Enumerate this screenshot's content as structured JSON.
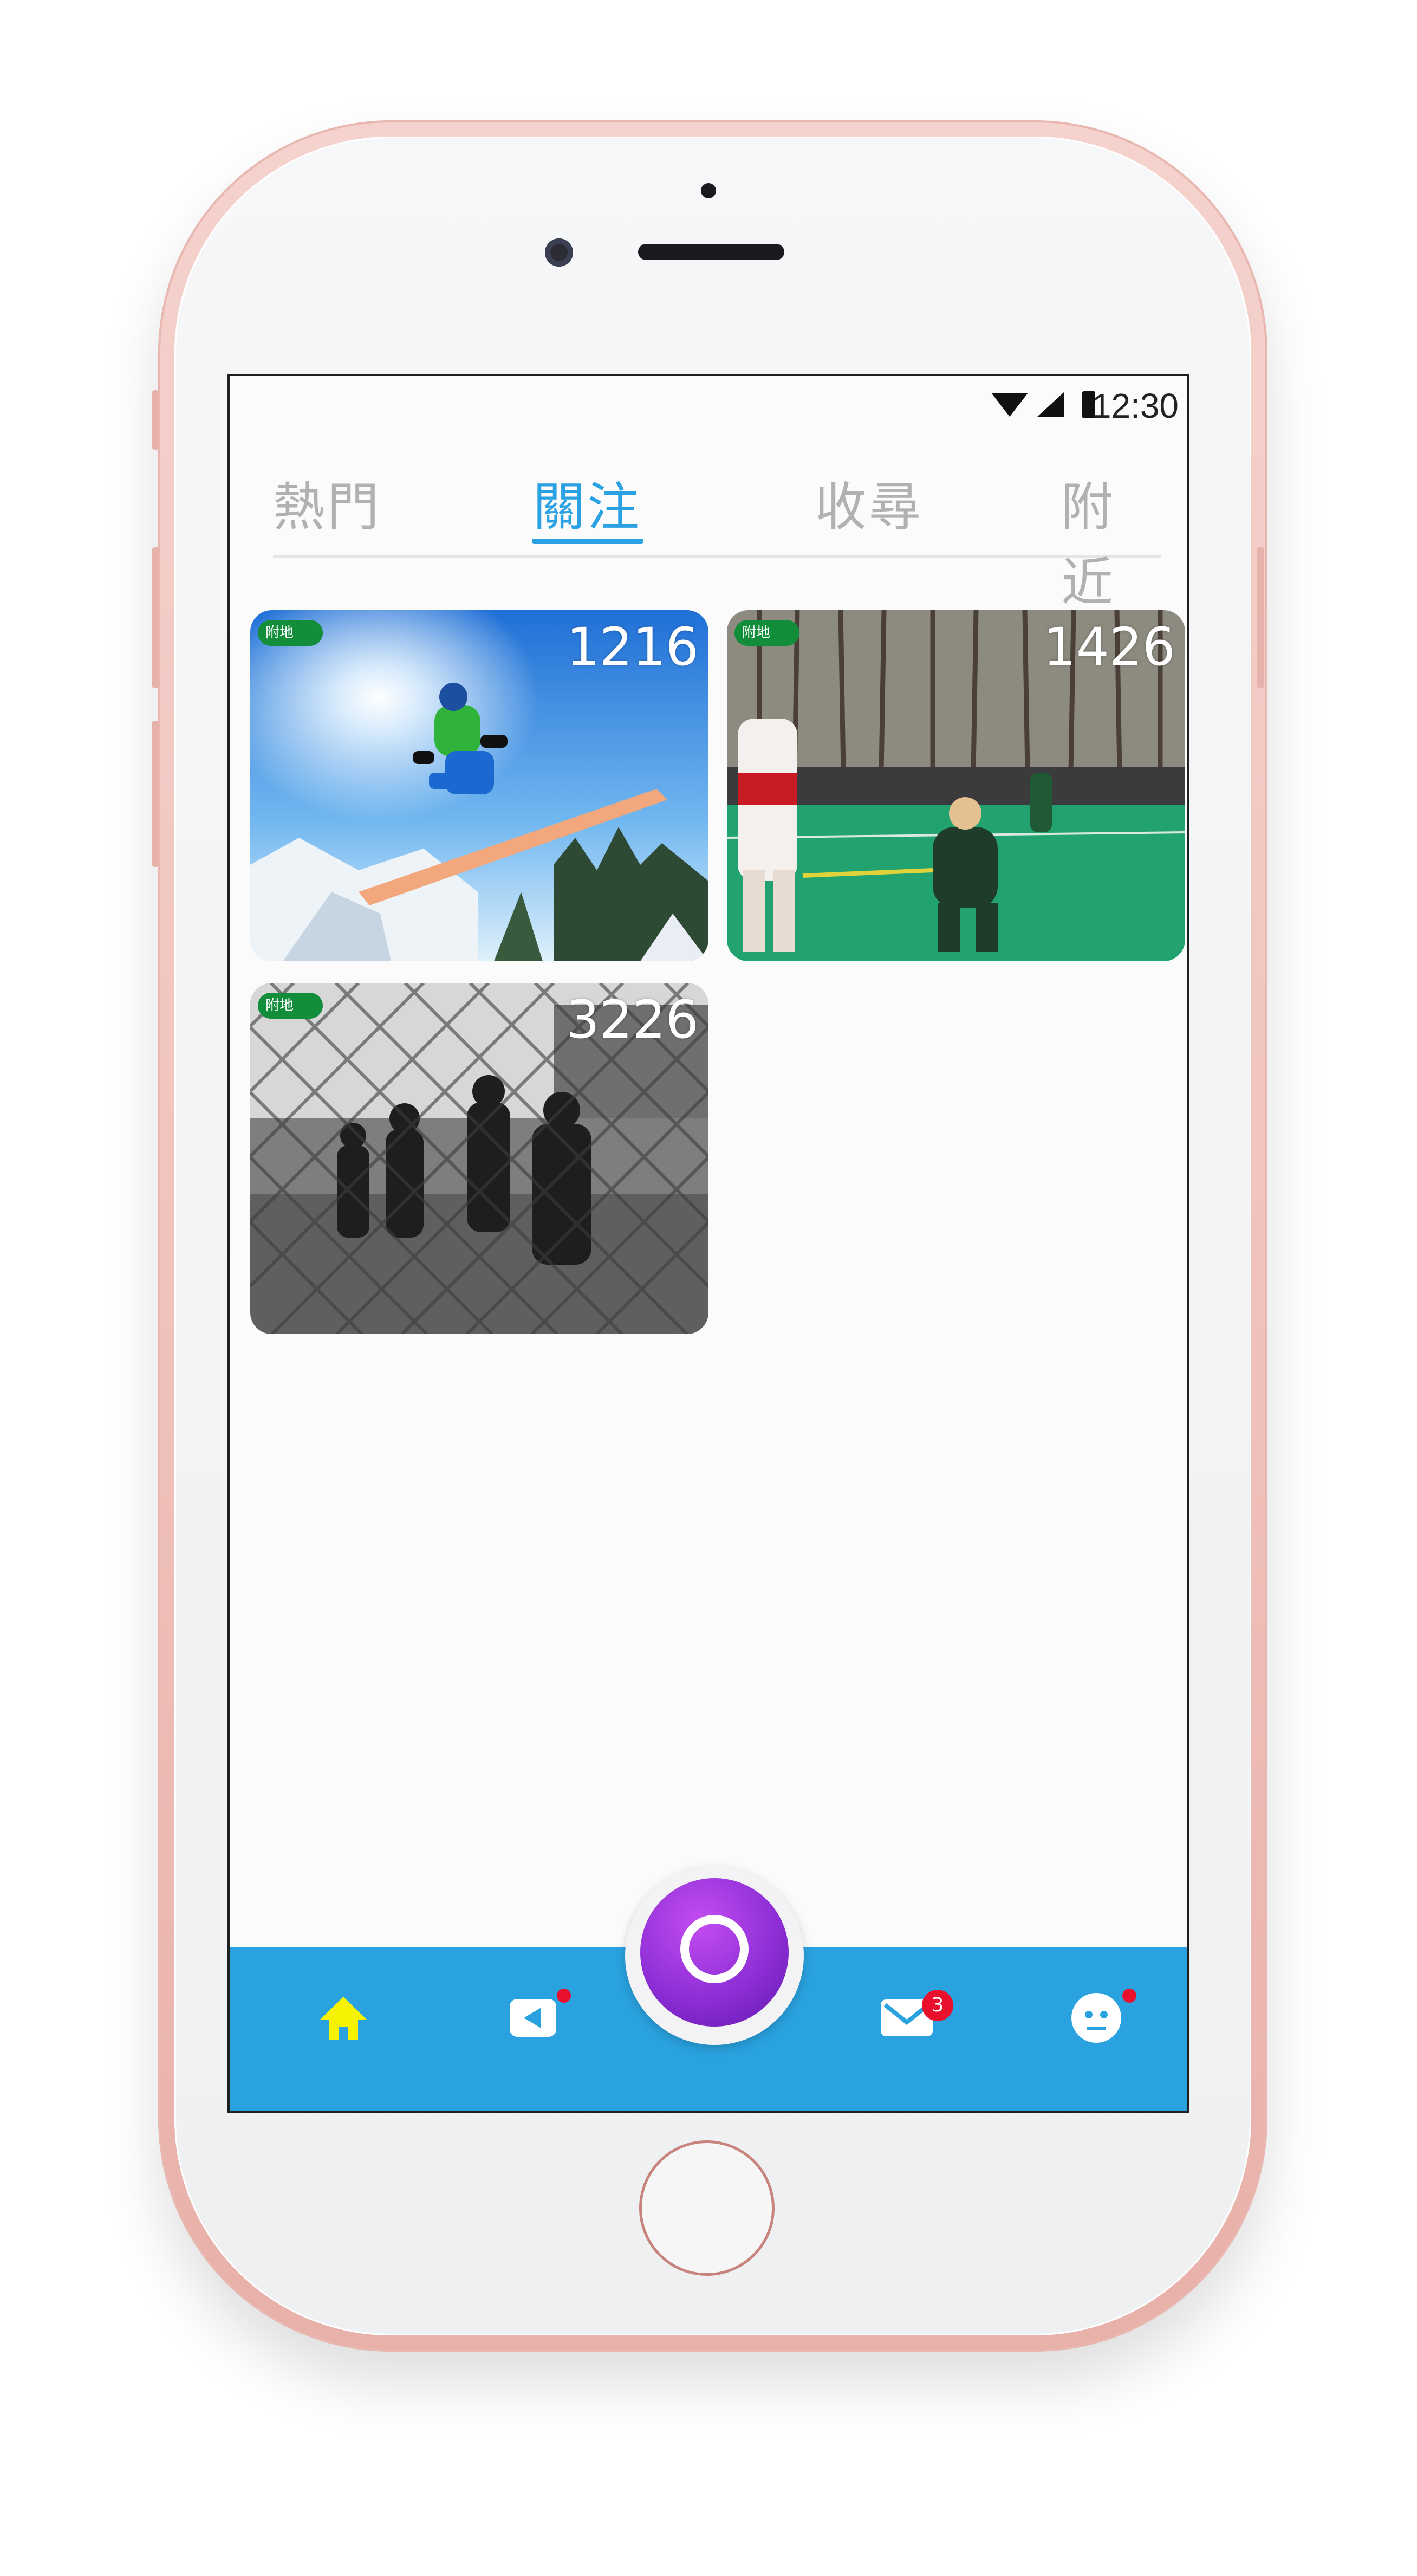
{
  "status_bar": {
    "time": "12:30"
  },
  "tabs": [
    {
      "label": "熱門",
      "active": false
    },
    {
      "label": "關注",
      "active": true
    },
    {
      "label": "收尋",
      "active": false
    },
    {
      "label": "附近",
      "active": false
    }
  ],
  "feed": [
    {
      "badge": "附地",
      "count": "1216",
      "scene": "snowboarder mid-air over snowy mountains"
    },
    {
      "badge": "附地",
      "count": "1426",
      "scene": "lacrosse players on green field"
    },
    {
      "badge": "附地",
      "count": "3226",
      "scene": "black and white street basketball behind fence"
    }
  ],
  "bottom_nav": {
    "home_icon": "home-icon",
    "video_icon": "video-icon",
    "record_icon": "record-icon",
    "mail_icon": "mail-icon",
    "mail_badge": "3",
    "profile_icon": "profile-icon"
  },
  "colors": {
    "accent": "#2aa1e2",
    "nav_bg": "#2aa2df",
    "home_active": "#f7f200",
    "record": "#8e2fd6",
    "badge_green": "#128e3a",
    "notification": "#e8102c",
    "phone_frame": "#f1c3bd"
  }
}
